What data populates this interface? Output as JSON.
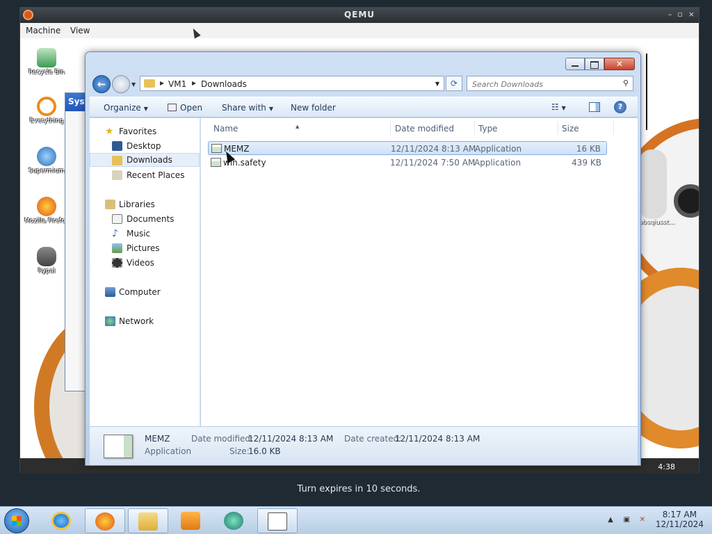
{
  "qemu": {
    "title": "QEMU",
    "menu": [
      "Machine",
      "View"
    ],
    "controls": [
      "–",
      "▫",
      "×"
    ]
  },
  "guest": {
    "desktop_icons": [
      {
        "label": "Recycle Bin",
        "icon": "recycle-bin-icon"
      },
      {
        "label": "Everything",
        "icon": "everything-icon"
      },
      {
        "label": "Supermium",
        "icon": "supermium-icon"
      },
      {
        "label": "Mozilla Firefox",
        "icon": "firefox-icon"
      },
      {
        "label": "Rypal",
        "icon": "rypal-icon"
      }
    ],
    "background_window_title": "Syst",
    "right_icon_label": "obsqiusst...",
    "clock": "4:38"
  },
  "explorer": {
    "breadcrumb": [
      "VM1",
      "Downloads"
    ],
    "search_placeholder": "Search Downloads",
    "toolbar": {
      "organize": "Organize",
      "open": "Open",
      "share_with": "Share with",
      "new_folder": "New folder"
    },
    "nav": {
      "favorites": "Favorites",
      "desktop": "Desktop",
      "downloads": "Downloads",
      "recent_places": "Recent Places",
      "libraries": "Libraries",
      "documents": "Documents",
      "music": "Music",
      "pictures": "Pictures",
      "videos": "Videos",
      "computer": "Computer",
      "network": "Network"
    },
    "columns": {
      "name": "Name",
      "date_modified": "Date modified",
      "type": "Type",
      "size": "Size"
    },
    "files": [
      {
        "name": "MEMZ",
        "date": "12/11/2024 8:13 AM",
        "type": "Application",
        "size": "16 KB",
        "selected": true
      },
      {
        "name": "win.safety",
        "date": "12/11/2024 7:50 AM",
        "type": "Application",
        "size": "439 KB",
        "selected": false
      }
    ],
    "details": {
      "name": "MEMZ",
      "type": "Application",
      "date_modified_label": "Date modified:",
      "date_modified": "12/11/2024 8:13 AM",
      "date_created_label": "Date created:",
      "date_created": "12/11/2024 8:13 AM",
      "size_label": "Size:",
      "size": "16.0 KB"
    }
  },
  "status_message": "Turn expires in 10 seconds.",
  "taskbar": {
    "apps": [
      "internet-explorer-icon",
      "firefox-icon",
      "file-explorer-icon",
      "media-player-icon",
      "app-icon",
      "notepad-icon"
    ],
    "time": "8:17 AM",
    "date": "12/11/2024"
  },
  "colors": {
    "accent": "#215ea8",
    "selection": "#cfe1f8",
    "qemu_frame": "#2b3238"
  }
}
